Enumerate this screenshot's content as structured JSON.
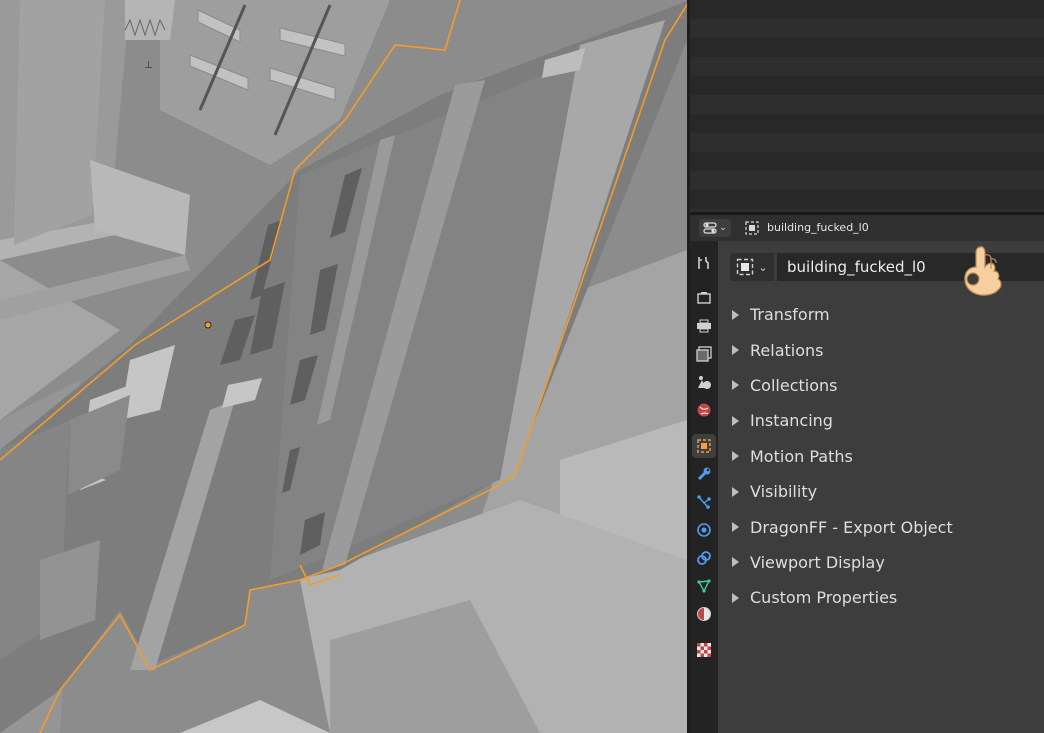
{
  "header": {
    "editor_type_icon": "properties-editor-icon",
    "object_icon": "object-icon",
    "object_name": "building_fucked_l0"
  },
  "tabs": [
    {
      "name": "tool",
      "icon": "tool-icon",
      "color": "#d0d0d0"
    },
    {
      "name": "render",
      "icon": "render-icon",
      "color": "#d0d0d0"
    },
    {
      "name": "output",
      "icon": "output-icon",
      "color": "#d0d0d0"
    },
    {
      "name": "view-layer",
      "icon": "view-layer-icon",
      "color": "#d0d0d0"
    },
    {
      "name": "scene",
      "icon": "scene-icon",
      "color": "#d0d0d0"
    },
    {
      "name": "world",
      "icon": "world-icon",
      "color": "#e05a5a"
    },
    {
      "name": "object",
      "icon": "object-icon",
      "color": "#f0a040",
      "active": true
    },
    {
      "name": "modifiers",
      "icon": "wrench-icon",
      "color": "#4f9cf0"
    },
    {
      "name": "particles",
      "icon": "particles-icon",
      "color": "#4f9cf0"
    },
    {
      "name": "physics",
      "icon": "physics-icon",
      "color": "#4f9cf0"
    },
    {
      "name": "constraints",
      "icon": "constraints-icon",
      "color": "#4f9cf0"
    },
    {
      "name": "data",
      "icon": "mesh-data-icon",
      "color": "#3fc99a"
    },
    {
      "name": "material",
      "icon": "material-icon",
      "color": "#e05a5a"
    },
    {
      "name": "texture",
      "icon": "texture-icon",
      "color": "#e05a5a"
    }
  ],
  "panel": {
    "name_field": "building_fucked_l0",
    "decor_icon": "ok-hand-icon",
    "sections": [
      {
        "label": "Transform"
      },
      {
        "label": "Relations"
      },
      {
        "label": "Collections"
      },
      {
        "label": "Instancing"
      },
      {
        "label": "Motion Paths"
      },
      {
        "label": "Visibility"
      },
      {
        "label": "DragonFF - Export Object"
      },
      {
        "label": "Viewport Display"
      },
      {
        "label": "Custom Properties"
      }
    ]
  },
  "colors": {
    "selection_outline": "#f39c2c",
    "panel_bg": "#3d3d3d",
    "outliner_bg": "#282828"
  }
}
